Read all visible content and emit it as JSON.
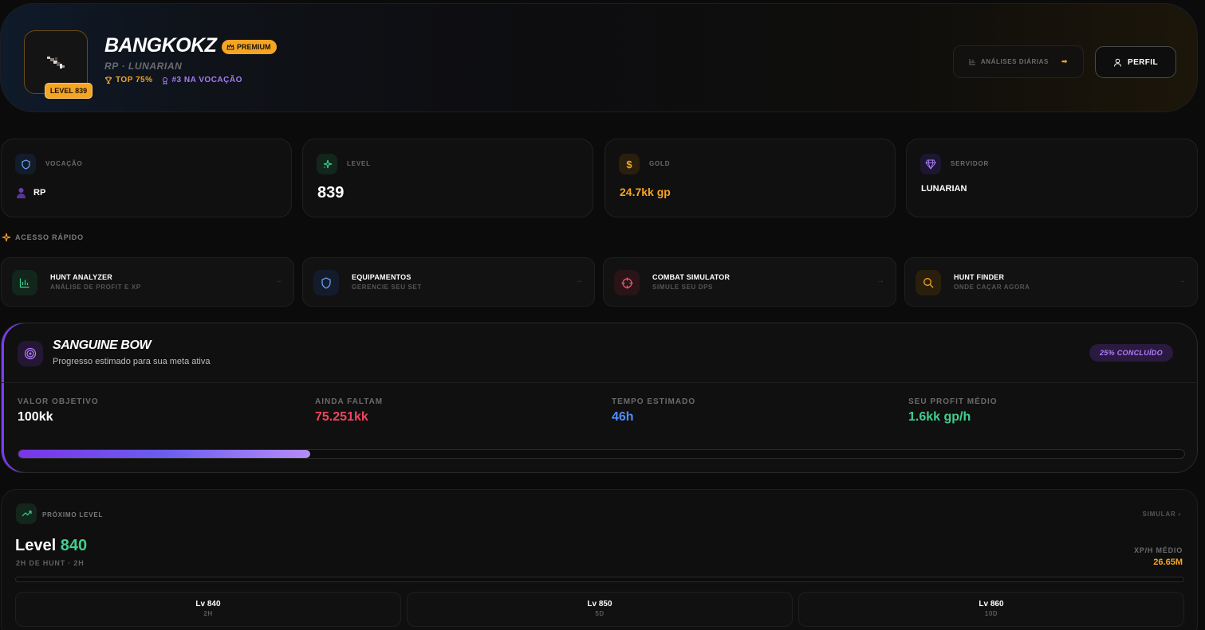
{
  "header": {
    "character_name": "BANGKOKZ",
    "premium_label": "PREMIUM",
    "subtitle": "RP · LUNARIAN",
    "level_badge": "LEVEL 839",
    "top_tag": "TOP 75%",
    "vocation_rank_tag": "#3 NA VOCAÇÃO",
    "analises_label": "ANÁLISES DIÁRIAS",
    "perfil_label": "PERFIL"
  },
  "stats": [
    {
      "label": "VOCAÇÃO",
      "value": "RP",
      "icon": "shield-icon",
      "color": "#6ea8ff"
    },
    {
      "label": "LEVEL",
      "value": "839",
      "icon": "sparkles-icon",
      "color": "#3ecf8e"
    },
    {
      "label": "GOLD",
      "value": "24.7kk gp",
      "icon": "dollar-icon",
      "color": "#f5a524"
    },
    {
      "label": "SERVIDOR",
      "value": "LUNARIAN",
      "icon": "gem-icon",
      "color": "#a77bf5"
    }
  ],
  "quick_access": {
    "title": "ACESSO RÁPIDO",
    "items": [
      {
        "name": "HUNT ANALYZER",
        "desc": "ANÁLISE DE PROFIT E XP",
        "icon": "bar-chart-icon",
        "color": "#3ecf8e"
      },
      {
        "name": "EQUIPAMENTOS",
        "desc": "GERENCIE SEU SET",
        "icon": "shield-icon",
        "color": "#6ea8ff"
      },
      {
        "name": "COMBAT SIMULATOR",
        "desc": "SIMULE SEU DPS",
        "icon": "crosshair-icon",
        "color": "#ef5a6f"
      },
      {
        "name": "HUNT FINDER",
        "desc": "ONDE CAÇAR AGORA",
        "icon": "search-icon",
        "color": "#f5a524"
      }
    ]
  },
  "goal": {
    "title": "SANGUINE BOW",
    "subtitle": "Progresso estimado para sua meta ativa",
    "badge": "25% CONCLUÍDO",
    "progress": 0.25,
    "columns": [
      {
        "label": "VALOR OBJETIVO",
        "value": "100kk",
        "color": "#ffffff"
      },
      {
        "label": "AINDA FALTAM",
        "value": "75.251kk",
        "color": "#f0445f"
      },
      {
        "label": "TEMPO ESTIMADO",
        "value": "46h",
        "color": "#4f8cff"
      },
      {
        "label": "SEU PROFIT MÉDIO",
        "value": "1.6kk gp/h",
        "color": "#3ecf8e"
      }
    ]
  },
  "next_level": {
    "label": "PRÓXIMO LEVEL",
    "simulate": "SIMULAR ›",
    "level_word": "Level",
    "level_num": "840",
    "hunt_text": "2H DE HUNT · 2H",
    "xp_label": "XP/H MÉDIO",
    "xp_value": "26.65M",
    "progress": 0.0,
    "tiles": [
      {
        "title": "Lv 840",
        "sub": "2H"
      },
      {
        "title": "Lv 850",
        "sub": "5D"
      },
      {
        "title": "Lv 860",
        "sub": "10D"
      }
    ]
  }
}
